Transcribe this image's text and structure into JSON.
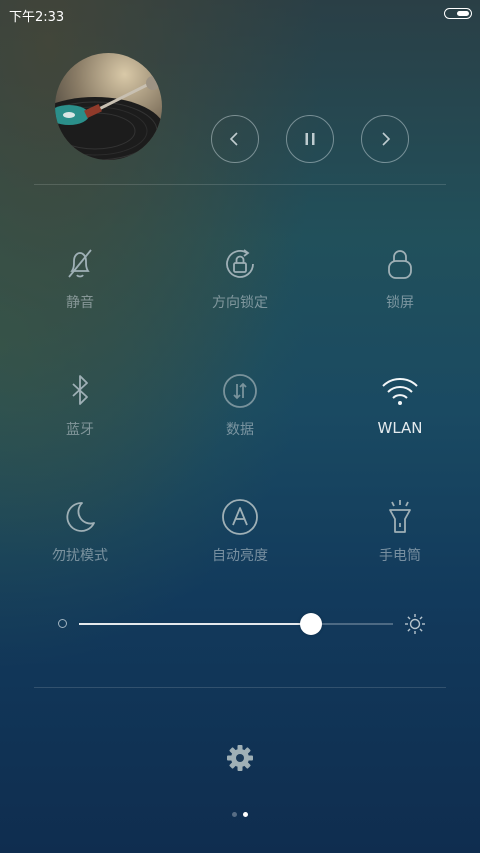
{
  "status_bar": {
    "time": "下午2:33",
    "battery_icon": "battery-icon"
  },
  "media": {
    "album_art": "record-player-album-art",
    "buttons": [
      {
        "name": "previous-button",
        "icon": "chevron-left-icon"
      },
      {
        "name": "pause-button",
        "icon": "pause-icon"
      },
      {
        "name": "next-button",
        "icon": "chevron-right-icon"
      }
    ]
  },
  "toggles": [
    {
      "label": "静音",
      "icon": "bell-off-icon",
      "active": false
    },
    {
      "label": "方向锁定",
      "icon": "rotation-lock-icon",
      "active": false
    },
    {
      "label": "锁屏",
      "icon": "lock-icon",
      "active": false
    },
    {
      "label": "蓝牙",
      "icon": "bluetooth-icon",
      "active": false
    },
    {
      "label": "数据",
      "icon": "mobile-data-icon",
      "active": false
    },
    {
      "label": "WLAN",
      "icon": "wifi-icon",
      "active": true
    },
    {
      "label": "勿扰模式",
      "icon": "moon-icon",
      "active": false
    },
    {
      "label": "自动亮度",
      "icon": "auto-brightness-icon",
      "active": false
    },
    {
      "label": "手电筒",
      "icon": "flashlight-icon",
      "active": false
    }
  ],
  "brightness": {
    "level": 0.74,
    "min_icon": "brightness-low-icon",
    "max_icon": "brightness-high-icon"
  },
  "settings": {
    "icon": "gear-icon"
  },
  "pager": {
    "count": 2,
    "active_index": 1
  },
  "colors": {
    "inactive_icon": "#9fb0b6",
    "active_icon": "#f2f6f8"
  }
}
